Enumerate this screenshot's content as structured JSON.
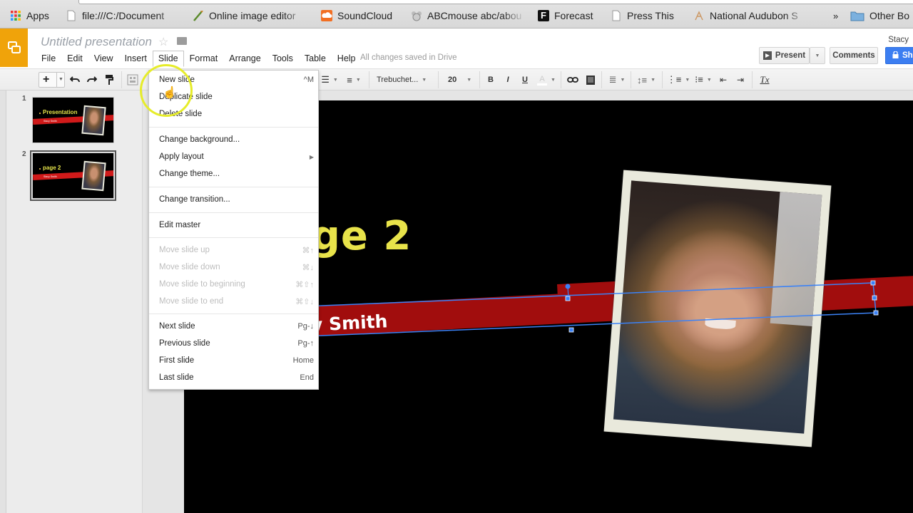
{
  "browser": {
    "bookmarks": [
      {
        "label": "Apps",
        "icon": "apps-grid-icon"
      },
      {
        "label": "file:///C:/Document",
        "icon": "file-icon"
      },
      {
        "label": "Online image editor",
        "icon": "paintbrush-icon"
      },
      {
        "label": "SoundCloud",
        "icon": "soundcloud-icon"
      },
      {
        "label": "ABCmouse abc/abou",
        "icon": "abcmouse-icon"
      },
      {
        "label": "Forecast",
        "icon": "forecast-icon"
      },
      {
        "label": "Press This",
        "icon": "file-icon"
      },
      {
        "label": "National Audubon S",
        "icon": "audubon-icon"
      },
      {
        "label": "»",
        "icon": "overflow-icon"
      },
      {
        "label": "Other Bo",
        "icon": "folder-icon"
      }
    ]
  },
  "header": {
    "doc_title": "Untitled presentation",
    "save_status": "All changes saved in Drive",
    "user_name": "Stacy",
    "present_label": "Present",
    "comments_label": "Comments",
    "share_label": "Sh",
    "menus": [
      "File",
      "Edit",
      "View",
      "Insert",
      "Slide",
      "Format",
      "Arrange",
      "Tools",
      "Table",
      "Help"
    ],
    "active_menu": "Slide"
  },
  "toolbar": {
    "font_name": "Trebuchet...",
    "font_size": "20",
    "bold": "B",
    "italic": "I",
    "underline": "U",
    "clear_format": "Tx"
  },
  "filmstrip": {
    "slides": [
      {
        "number": "1",
        "title": "Presentation",
        "subtitle": "Stacy Smith",
        "selected": false
      },
      {
        "number": "2",
        "title": "page 2",
        "subtitle": "Stacy Smith",
        "selected": true
      }
    ]
  },
  "slide": {
    "title": "age 2",
    "subtitle": "y Smith",
    "colors": {
      "background": "#000000",
      "title": "#e8e34a",
      "band": "#a10d0d",
      "selection": "#3b82f6"
    }
  },
  "slide_menu": {
    "groups": [
      [
        {
          "label": "New slide",
          "shortcut": "^M",
          "disabled": false
        },
        {
          "label": "Duplicate slide",
          "shortcut": "",
          "disabled": false
        },
        {
          "label": "Delete slide",
          "shortcut": "",
          "disabled": false
        }
      ],
      [
        {
          "label": "Change background...",
          "shortcut": "",
          "disabled": false
        },
        {
          "label": "Apply layout",
          "shortcut": "▶",
          "disabled": false,
          "submenu": true
        },
        {
          "label": "Change theme...",
          "shortcut": "",
          "disabled": false
        }
      ],
      [
        {
          "label": "Change transition...",
          "shortcut": "",
          "disabled": false
        }
      ],
      [
        {
          "label": "Edit master",
          "shortcut": "",
          "disabled": false
        }
      ],
      [
        {
          "label": "Move slide up",
          "shortcut": "⌘↑",
          "disabled": true
        },
        {
          "label": "Move slide down",
          "shortcut": "⌘↓",
          "disabled": true
        },
        {
          "label": "Move slide to beginning",
          "shortcut": "⌘⇧↑",
          "disabled": true
        },
        {
          "label": "Move slide to end",
          "shortcut": "⌘⇧↓",
          "disabled": true
        }
      ],
      [
        {
          "label": "Next slide",
          "shortcut": "Pg-↓",
          "disabled": false
        },
        {
          "label": "Previous slide",
          "shortcut": "Pg-↑",
          "disabled": false
        },
        {
          "label": "First slide",
          "shortcut": "Home",
          "disabled": false
        },
        {
          "label": "Last slide",
          "shortcut": "End",
          "disabled": false
        }
      ]
    ]
  }
}
